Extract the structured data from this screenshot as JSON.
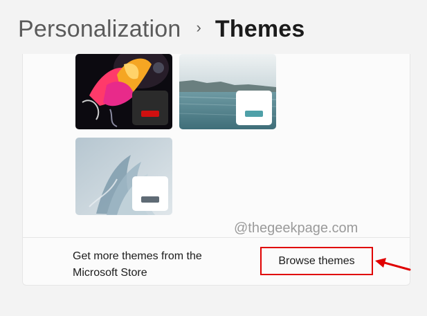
{
  "breadcrumb": {
    "parent": "Personalization",
    "separator": "›",
    "current": "Themes"
  },
  "themes": [
    {
      "name": "theme-dark-bloom",
      "window_color": "#2b2b2b",
      "accent_color": "#d01010"
    },
    {
      "name": "theme-lake",
      "window_color": "#ffffff",
      "accent_color": "#4fa0a8"
    },
    {
      "name": "theme-glow",
      "window_color": "#ffffff",
      "accent_color": "#5f6b75"
    }
  ],
  "watermark": "@thegeekpage.com",
  "store": {
    "text": "Get more themes from the Microsoft Store",
    "button_label": "Browse themes"
  },
  "colors": {
    "highlight": "#e00000",
    "background": "#f3f3f3",
    "panel": "#fbfbfb"
  }
}
